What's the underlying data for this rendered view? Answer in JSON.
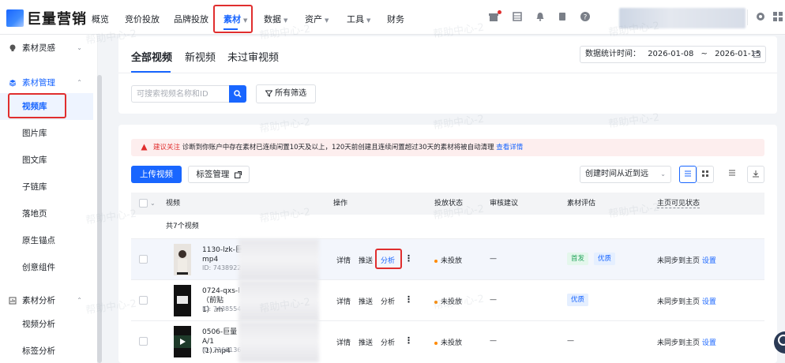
{
  "brand": {
    "name": "巨量营销"
  },
  "nav": {
    "items": [
      {
        "label": "概览",
        "caret": false
      },
      {
        "label": "竞价投放",
        "caret": false
      },
      {
        "label": "品牌投放",
        "caret": false
      },
      {
        "label": "素材",
        "caret": true
      },
      {
        "label": "数据",
        "caret": true
      },
      {
        "label": "资产",
        "caret": true
      },
      {
        "label": "工具",
        "caret": true
      },
      {
        "label": "财务",
        "caret": false
      }
    ],
    "caret_glyph": "▼",
    "active_index": 3
  },
  "sidebar": {
    "groups": [
      {
        "label": "素材灵感",
        "icon": "bulb-icon"
      },
      {
        "label": "素材管理",
        "icon": "stack-icon"
      },
      {
        "label": "素材分析",
        "icon": "chart-icon"
      }
    ],
    "items": [
      "视频库",
      "图片库",
      "图文库",
      "子链库",
      "落地页",
      "原生锚点",
      "创意组件",
      "视频分析",
      "标签分析"
    ]
  },
  "tabs": {
    "items": [
      "全部视频",
      "新视频",
      "未过审视频"
    ]
  },
  "date_range": {
    "label": "数据统计时间：",
    "start": "2026-01-08",
    "separator": "~",
    "end": "2026-01-15"
  },
  "search": {
    "placeholder": "可搜索视频名称和ID"
  },
  "filter": {
    "label": "所有筛选"
  },
  "notice": {
    "title": "建议关注",
    "text": "诊断到你账户中存在素材已连续闲置10天及以上，120天前创建且连续闲置超过30天的素材将被自动清理",
    "link": "查看详情"
  },
  "toolbar": {
    "upload": "上传视频",
    "tag_manage": "标签管理",
    "sort": "创建时间从近到远"
  },
  "table": {
    "headers": [
      "视频",
      "操作",
      "投放状态",
      "审核建议",
      "素材评估",
      "主页可见状态"
    ],
    "count": "共7个视频",
    "actions": [
      "详情",
      "推送",
      "分析"
    ],
    "rows": [
      {
        "name": "1130-lzk-巨 mp4",
        "id": "ID: 7438922",
        "status": "未投放",
        "review": "—",
        "tags": [
          "首发",
          "优质"
        ],
        "homepage": "未同步到主页",
        "setting": "设置"
      },
      {
        "name": "0724-qxs-l（前贴1）.m",
        "id": "ID: 7438554",
        "status": "未投放",
        "review": "—",
        "tags": [
          "优质"
        ],
        "homepage": "未同步到主页",
        "setting": "设置"
      },
      {
        "name": "0506-巨量 A/1 (1).mp4",
        "id": "ID: 7366136",
        "status": "未投放",
        "review": "—",
        "score": "—",
        "tags": [],
        "homepage": "未同步到主页",
        "setting": "设置"
      }
    ]
  },
  "watermark": "帮助中心-2"
}
